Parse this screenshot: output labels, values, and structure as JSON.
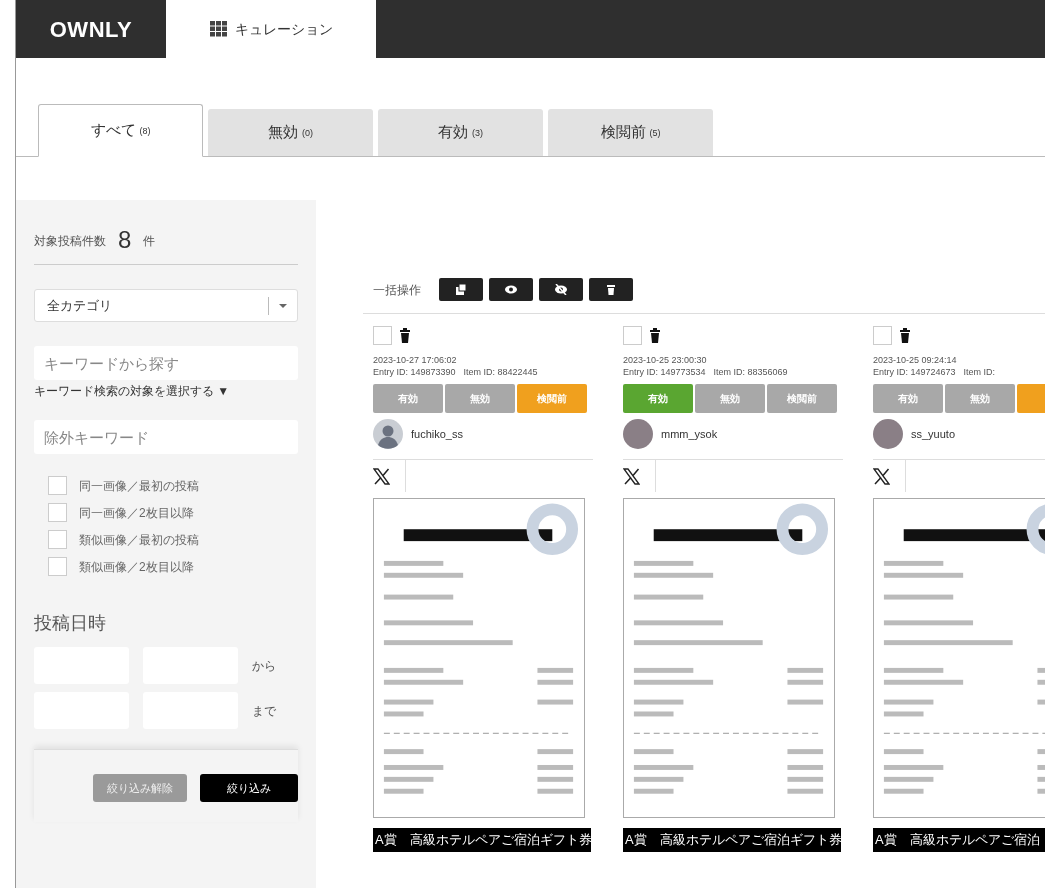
{
  "header": {
    "logo": "OWNLY",
    "nav": {
      "label": "キュレーション",
      "selected": true
    }
  },
  "tabs": [
    {
      "label": "すべて",
      "count": "(8)",
      "selected": true
    },
    {
      "label": "無効",
      "count": "(0)",
      "selected": false
    },
    {
      "label": "有効",
      "count": "(3)",
      "selected": false
    },
    {
      "label": "検閲前",
      "count": "(5)",
      "selected": false
    }
  ],
  "sidebar": {
    "count_label": "対象投稿件数",
    "count": "8",
    "count_unit": "件",
    "category": {
      "value": "全カテゴリ"
    },
    "keyword": {
      "placeholder": "キーワードから探す"
    },
    "keyword_target": "キーワード検索の対象を選択する ▼",
    "exclude": {
      "placeholder": "除外キーワード"
    },
    "filters": [
      {
        "label": "同一画像／最初の投稿",
        "checked": false
      },
      {
        "label": "同一画像／2枚目以降",
        "checked": false
      },
      {
        "label": "類似画像／最初の投稿",
        "checked": false
      },
      {
        "label": "類似画像／2枚目以降",
        "checked": false
      }
    ],
    "date": {
      "title": "投稿日時",
      "from": "から",
      "to": "まで"
    },
    "buttons": [
      {
        "label": "絞り込み解除",
        "kind": "secondary"
      },
      {
        "label": "絞り込み",
        "kind": "primary"
      }
    ]
  },
  "bulk": {
    "label": "一括操作",
    "actions": [
      {
        "kind": "copy"
      },
      {
        "kind": "show"
      },
      {
        "kind": "hide"
      },
      {
        "kind": "delete"
      }
    ]
  },
  "posts": [
    {
      "checked": false,
      "date": "2023-10-27 17:06:02",
      "entry_id": "Entry ID: 149873390",
      "item_id": "Item ID: 88422445",
      "statuses": [
        {
          "label": "有効",
          "selected": false
        },
        {
          "label": "無効",
          "selected": false
        },
        {
          "label": "検閲前",
          "selected": true
        }
      ],
      "avatar": {
        "kind": "silhouette"
      },
      "user": "fuchiko_ss",
      "prize": "A賞　高級ホテルペアご宿泊ギフト券"
    },
    {
      "checked": false,
      "date": "2023-10-25 23:00:30",
      "entry_id": "Entry ID: 149773534",
      "item_id": "Item ID: 88356069",
      "statuses": [
        {
          "label": "有効",
          "selected": true
        },
        {
          "label": "無効",
          "selected": false
        },
        {
          "label": "検閲前",
          "selected": false
        }
      ],
      "avatar": {
        "kind": "photo"
      },
      "user": "mmm_ysok",
      "prize": "A賞　高級ホテルペアご宿泊ギフト券"
    },
    {
      "checked": false,
      "date": "2023-10-25 09:24:14",
      "entry_id": "Entry ID: 149724673",
      "item_id": "Item ID:",
      "statuses": [
        {
          "label": "有効",
          "selected": false
        },
        {
          "label": "無効",
          "selected": false
        },
        {
          "selected": true
        }
      ],
      "avatar": {
        "kind": "photo"
      },
      "user": "ss_yuuto",
      "prize": "A賞　高級ホテルペアご宿泊"
    }
  ]
}
